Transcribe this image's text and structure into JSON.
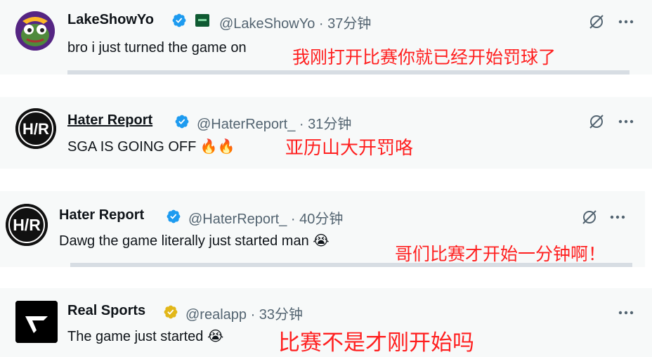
{
  "colors": {
    "verified_blue": "#1d9bf0",
    "verified_gold": "#e2b719",
    "annotation_red": "#ff1f1f",
    "handle_gray": "#536471",
    "card_bg": "#f7f9f9"
  },
  "posts": [
    {
      "name": "LakeShowYo",
      "handle": "@LakeShowYo · 37分钟",
      "text": "bro i just turned the game on",
      "annotation": "我刚打开比赛你就已经开始罚球了",
      "badge": "verified-blue",
      "avatar_icon": "frog-avatar-icon"
    },
    {
      "name": "Hater Report",
      "handle": "@HaterReport_ · 31分钟",
      "text": "SGA IS GOING OFF 🔥🔥",
      "annotation": "亚历山大开罚咯",
      "badge": "verified-blue",
      "avatar_icon": "hr-logo-icon"
    },
    {
      "name": "Hater Report",
      "handle": "@HaterReport_ · 40分钟",
      "text": "Dawg the game literally just started man 😭",
      "annotation": "哥们比赛才开始一分钟啊！",
      "badge": "verified-blue",
      "avatar_icon": "hr-logo-icon"
    },
    {
      "name": "Real Sports",
      "handle": "@realapp · 33分钟",
      "text": "The game just started 😭",
      "annotation": "比赛不是才刚开始吗",
      "badge": "verified-gold",
      "avatar_icon": "real-sports-logo-icon"
    }
  ]
}
